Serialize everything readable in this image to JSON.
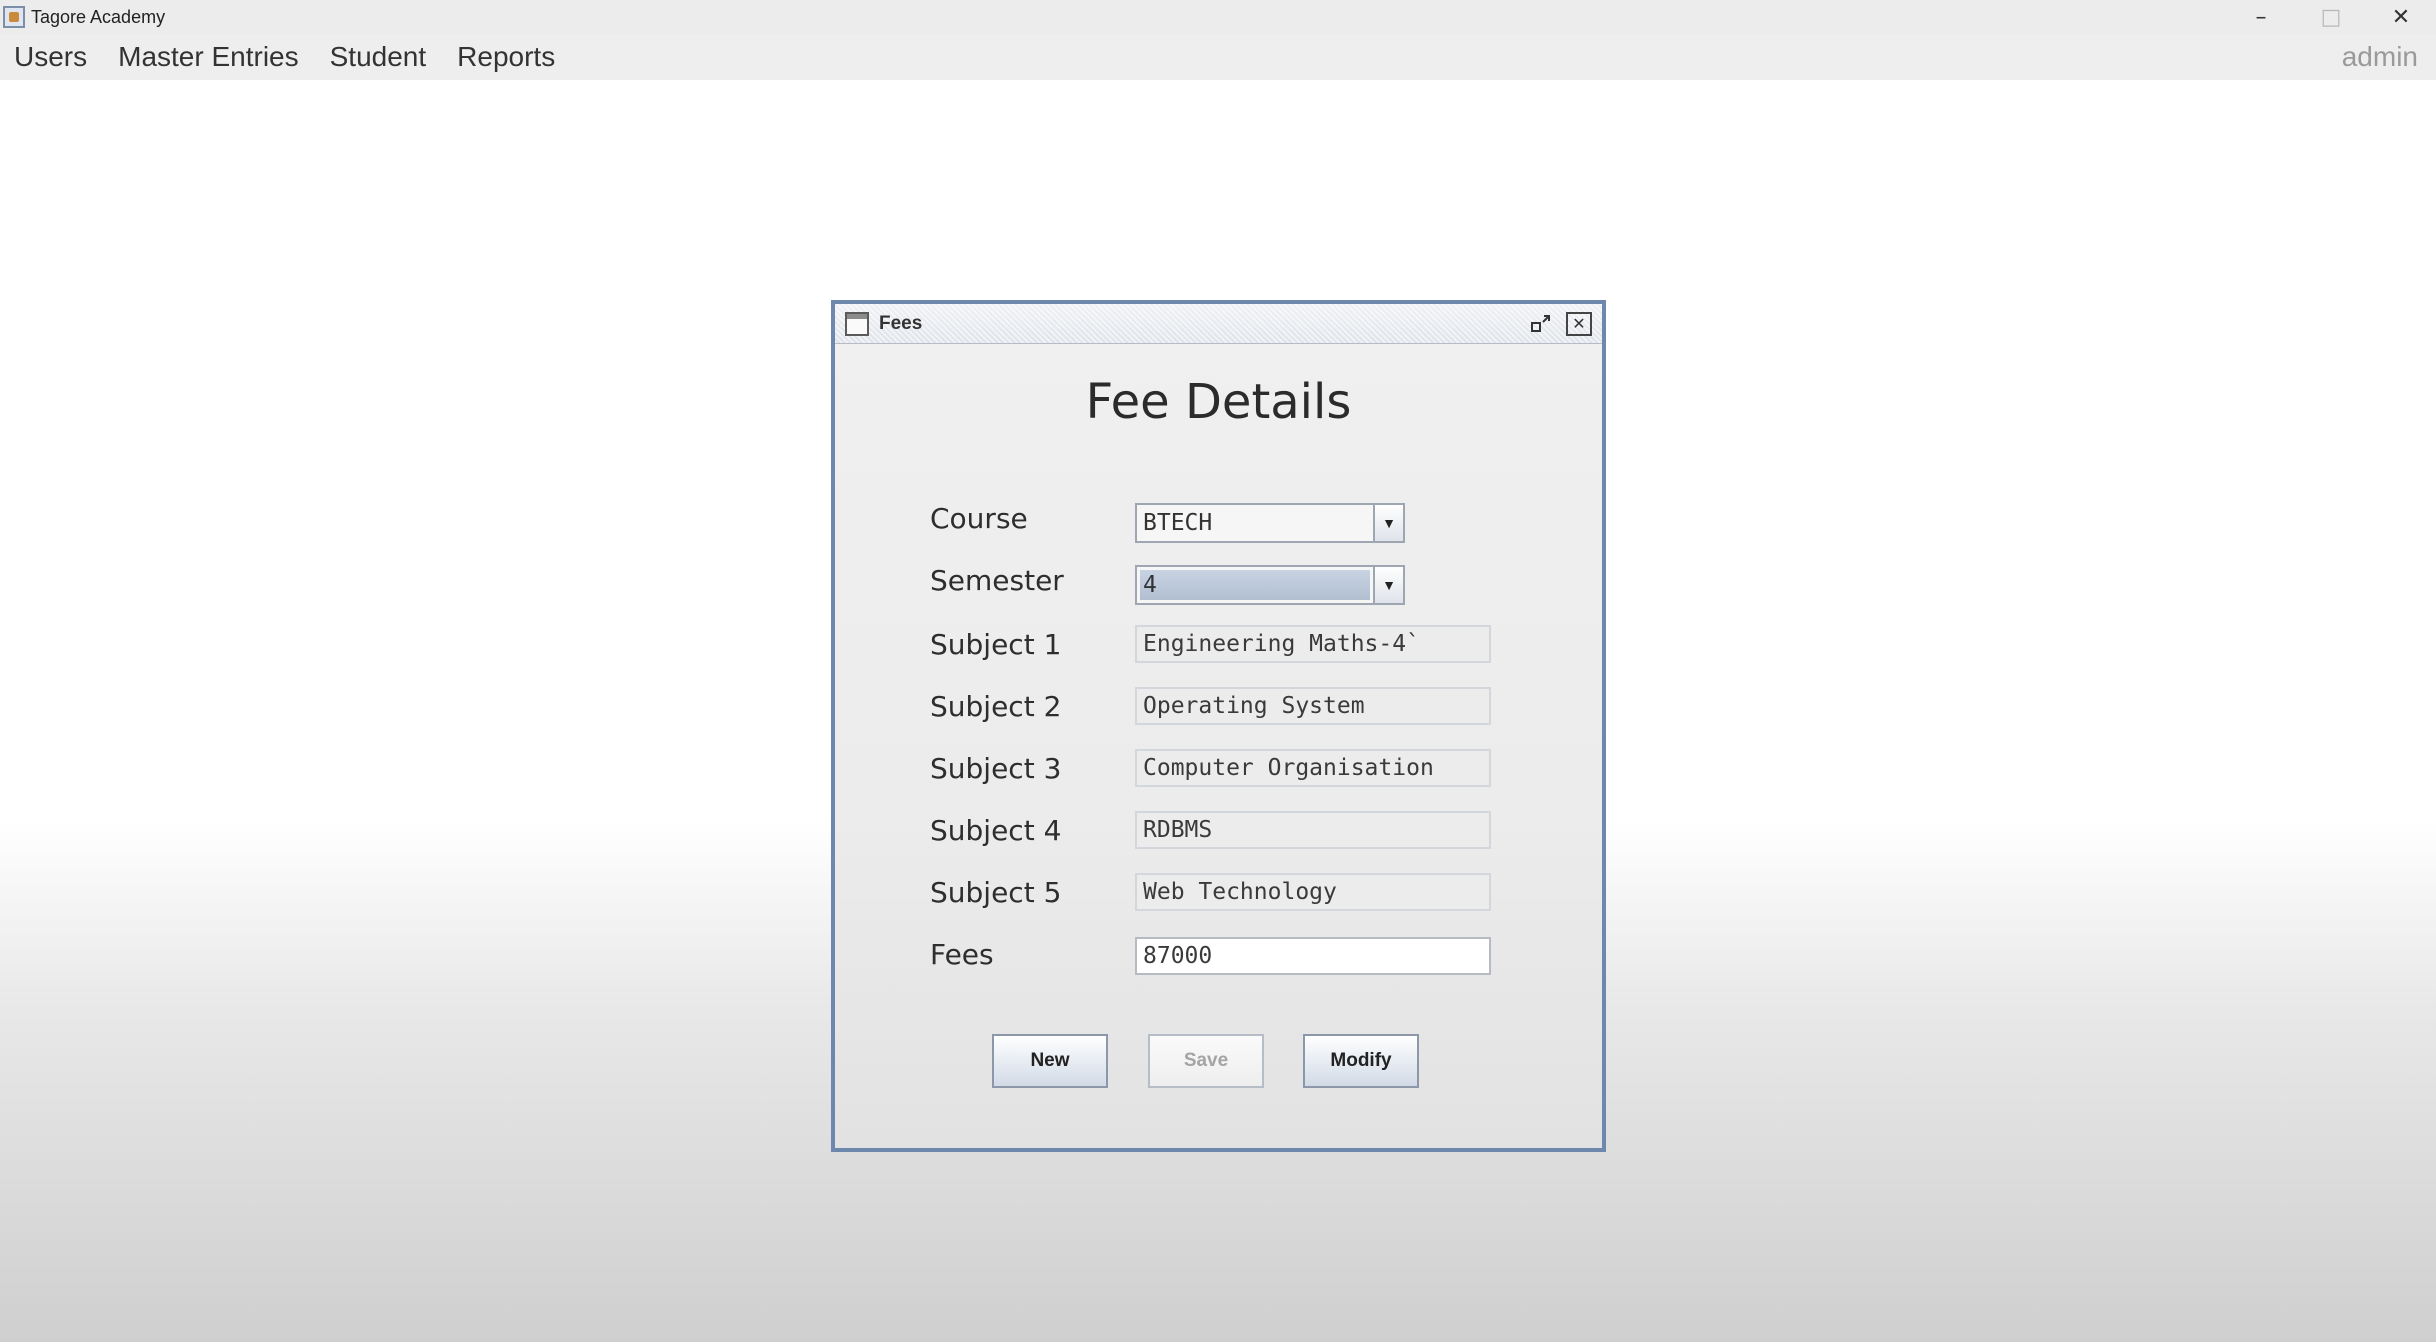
{
  "window": {
    "title": "Tagore Academy",
    "controls": {
      "minimize": "–",
      "maximize": "□",
      "close": "✕"
    }
  },
  "menu": {
    "items": [
      "Users",
      "Master Entries",
      "Student",
      "Reports"
    ],
    "user": "admin"
  },
  "fees_frame": {
    "title": "Fees",
    "heading": "Fee Details",
    "fields": {
      "course": {
        "label": "Course",
        "value": "BTECH"
      },
      "semester": {
        "label": "Semester",
        "value": "4"
      },
      "subject1": {
        "label": "Subject 1",
        "value": "Engineering Maths-4`"
      },
      "subject2": {
        "label": "Subject 2",
        "value": "Operating System"
      },
      "subject3": {
        "label": "Subject 3",
        "value": "Computer Organisation"
      },
      "subject4": {
        "label": "Subject 4",
        "value": "RDBMS"
      },
      "subject5": {
        "label": "Subject 5",
        "value": "Web Technology"
      },
      "fees": {
        "label": "Fees",
        "value": "87000"
      }
    },
    "buttons": {
      "new": "New",
      "save": "Save",
      "modify": "Modify"
    }
  }
}
